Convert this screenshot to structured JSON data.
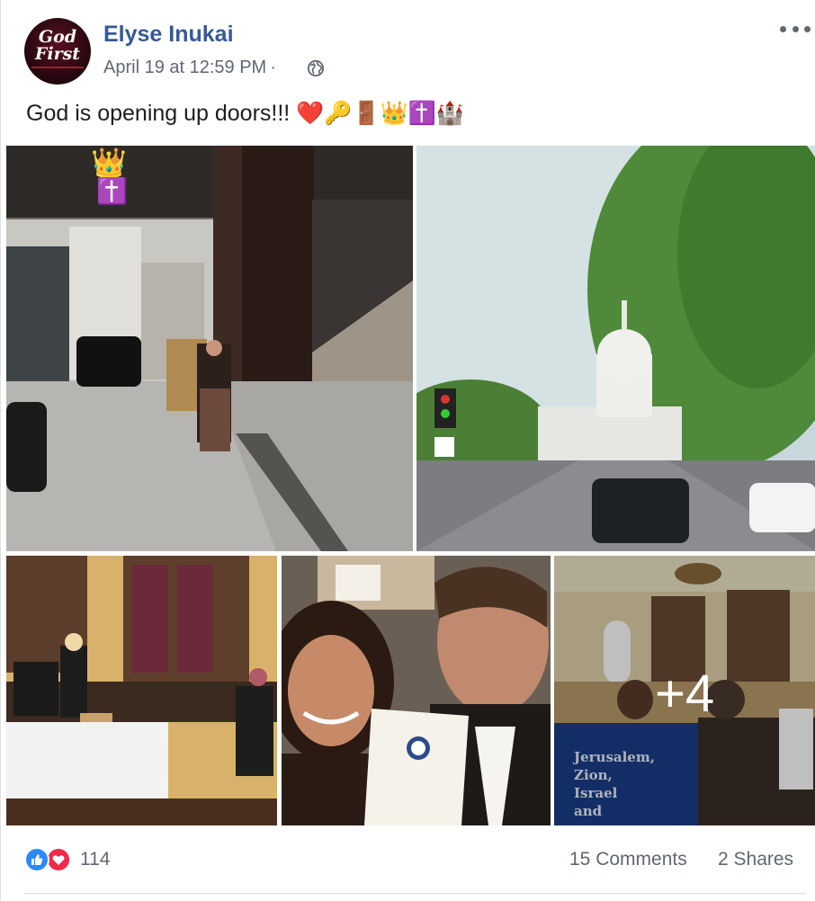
{
  "post": {
    "author": "Elyse Inukai",
    "avatar_text": "God First",
    "timestamp": "April 19 at 12:59 PM",
    "separator": "·",
    "privacy_icon": "globe-icon",
    "menu_icon": "ellipsis-icon",
    "text": "God is opening up doors!!! ❤️🔑🚪👑✝️🏰"
  },
  "photos": {
    "photo1": {
      "overlay_emoji": "👑",
      "overlay_emoji_2": "✝️"
    },
    "photo5": {
      "more_count": "+4",
      "sign_lines": [
        "Jerusalem,",
        "Zion,",
        "Israel",
        "and"
      ]
    }
  },
  "footer": {
    "reaction_icons": [
      "like-icon",
      "love-icon"
    ],
    "reaction_count": "114",
    "comments": "15 Comments",
    "shares": "2 Shares"
  },
  "colors": {
    "author_link": "#365899",
    "meta_text": "#606770",
    "like_blue": "#2d88ff",
    "love_red": "#f0284a"
  }
}
